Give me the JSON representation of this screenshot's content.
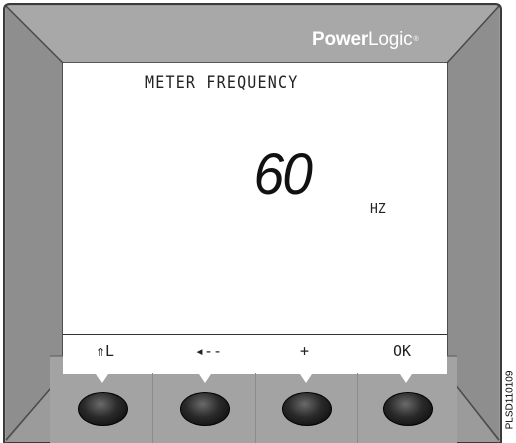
{
  "brand": {
    "name_bold": "Power",
    "name_light": "Logic",
    "reg_mark": "®"
  },
  "screen": {
    "title": "METER FREQUENCY",
    "value": "60",
    "unit": "HZ"
  },
  "softkeys": [
    {
      "label": "⇑L",
      "icon": "up-level-icon"
    },
    {
      "label": "◂--",
      "icon": "left-arrow-icon"
    },
    {
      "label": "+",
      "icon": "increment-icon"
    },
    {
      "label": "OK",
      "icon": "ok-icon"
    }
  ],
  "side_code": "PLSD110109",
  "colors": {
    "bezel": "#9b9b9b",
    "bezel_dark": "#6f6f6f",
    "lcd": "#ffffff",
    "knob": "#111111"
  }
}
